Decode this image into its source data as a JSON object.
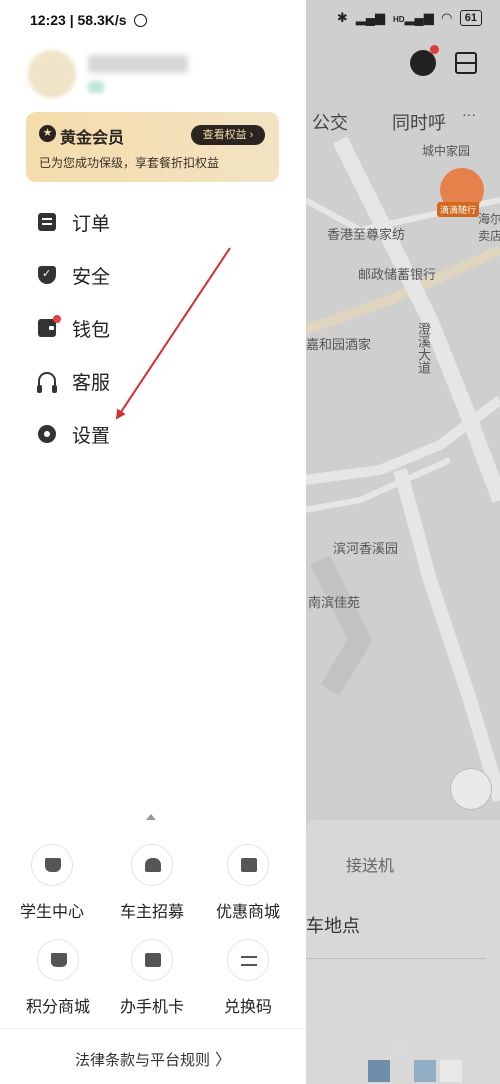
{
  "status_bar": {
    "time_speed": "12:23 | 58.3K/s",
    "battery": "61",
    "wifi_label": "HD"
  },
  "profile": {
    "avatar": "blurred-avatar",
    "name": "",
    "badge": ""
  },
  "vip": {
    "title": "黄金会员",
    "button": "查看权益 ›",
    "subtitle": "已为您成功保级，享套餐折扣权益"
  },
  "menu": [
    {
      "label": "订单",
      "icon": "order-icon"
    },
    {
      "label": "安全",
      "icon": "shield-icon"
    },
    {
      "label": "钱包",
      "icon": "wallet-icon",
      "badge": true
    },
    {
      "label": "客服",
      "icon": "headset-icon"
    },
    {
      "label": "设置",
      "icon": "gear-icon"
    }
  ],
  "shortcuts": [
    {
      "label": "学生中心",
      "icon": "graduation-cap-icon"
    },
    {
      "label": "车主招募",
      "icon": "driver-recruit-icon"
    },
    {
      "label": "优惠商城",
      "icon": "discount-mall-icon"
    },
    {
      "label": "积分商城",
      "icon": "cart-icon"
    },
    {
      "label": "办手机卡",
      "icon": "sim-card-icon"
    },
    {
      "label": "兑换码",
      "icon": "exchange-icon"
    }
  ],
  "footer": {
    "legal_link": "法律条款与平台规则"
  },
  "map": {
    "tabs": [
      "公交",
      "同时呼",
      "···"
    ],
    "partial_top_label": "城中家园",
    "promo_badge": "滴滴随行",
    "places": [
      "香港至尊家纺",
      "海尔专卖店",
      "邮政储蓄银行",
      "嘉和园酒家",
      "滨河香溪园",
      "南滨佳苑"
    ],
    "road": "澄溪大道",
    "card_tab": "接送机",
    "card_text": "车地点"
  },
  "colors": {
    "vip_gradient_start": "#f4dcab",
    "vip_dark": "#2b2420",
    "badge_red": "#e84040",
    "annotation_arrow": "#d32f2f",
    "map_dim": "#cfcfcf"
  }
}
